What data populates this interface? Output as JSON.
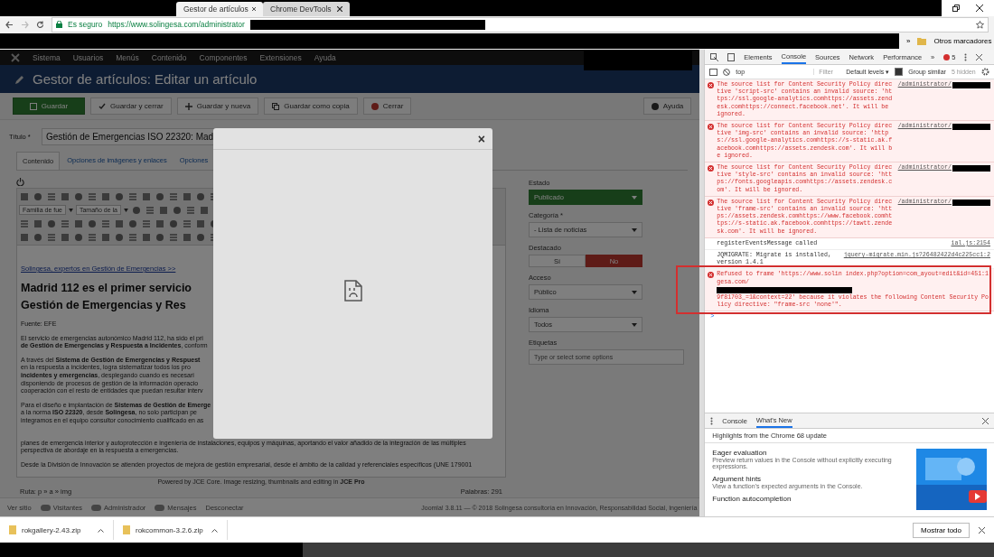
{
  "browser": {
    "tabs": [
      {
        "label": "Gestor de artículos",
        "selected": true
      },
      {
        "label": "Chrome DevTools",
        "selected": false
      }
    ],
    "secure_label": "Es seguro",
    "url": "https://www.solingesa.com/administrator",
    "bookmarks_overflow": "»",
    "other_bookmarks": "Otros marcadores"
  },
  "cms": {
    "menu": [
      "Sistema",
      "Usuarios",
      "Menús",
      "Contenido",
      "Componentes",
      "Extensiones",
      "Ayuda"
    ],
    "page_title": "Gestor de artículos: Editar un artículo",
    "toolbar": [
      {
        "label": "Guardar",
        "kind": "primary"
      },
      {
        "label": "Guardar y cerrar",
        "kind": "check"
      },
      {
        "label": "Guardar y nueva",
        "kind": "plus"
      },
      {
        "label": "Guardar como copia",
        "kind": "copy"
      },
      {
        "label": "Cerrar",
        "kind": "close"
      }
    ],
    "help": "Ayuda",
    "title_label": "Título *",
    "title_value": "Gestión de Emergencias ISO 22320: Mad",
    "tabs": [
      {
        "label": "Contenido",
        "selected": true
      },
      {
        "label": "Opciones de imágenes y enlaces",
        "selected": false
      },
      {
        "label": "Opciones",
        "selected": false
      }
    ],
    "editor": {
      "font_family": "Familia de fue",
      "font_size": "Tamaño de la",
      "intro_link": "Solingesa, expertos en Gestión de Emergencias >>",
      "heading": [
        "Madrid 112 es el primer servicio",
        "Gestión de Emergencias y Res"
      ],
      "source": "Fuente: EFE",
      "paragraphs": [
        [
          "El servicio de emergencias autonómico Madrid 112, ha sido el pri",
          "**de Gestión de Emergencias y Respuesta a Incidentes**, conform"
        ],
        [
          "A través del **Sistema de Gestión de Emergencias y Respuest**",
          "en la respuesta a incidentes, logra sistematizar todos los pro",
          "**incidentes y emergencias**, desplegando cuando es necesari",
          "disponiendo de procesos de gestión de la información operacio",
          "cooperación con el resto de entidades que puedan resultar interv"
        ],
        [
          "Para el diseño e implantación de **Sistemas de Gestión de Emerge**",
          "a la norma **ISO 22320**, desde **Solingesa**, no solo participan pe",
          "integramos en el equipo consultor conocimiento cualificado en as"
        ]
      ],
      "wide_lines": [
        [
          "planes de emergencia interior y autoprotección e ingeniería de instalaciones, equipos y máquinas, aportando el valor añadido de la integración de las múltiples",
          "perspectiva de abordaje en la respuesta a emergencias."
        ],
        [
          "Desde la División de Innovación se atienden proyectos de mejora de gestión empresarial, desde el ámbito de la calidad y referenciales específicos (UNE 179001"
        ]
      ],
      "powered": "Powered by JCE Core. Image resizing, thumbnails and editing in **JCE Pro**",
      "path": "Ruta: p » a » img",
      "words": "Palabras: 291"
    },
    "sidebar": [
      {
        "label": "Estado",
        "kind": "status",
        "value": "Publicado"
      },
      {
        "label": "Categoría *",
        "kind": "select",
        "value": "- Lista de noticias"
      },
      {
        "label": "Destacado",
        "kind": "toggle",
        "options": [
          {
            "label": "Sí",
            "selected": false
          },
          {
            "label": "No",
            "selected": true
          }
        ]
      },
      {
        "label": "Acceso",
        "kind": "select",
        "value": "Público"
      },
      {
        "label": "Idioma",
        "kind": "select",
        "value": "Todos"
      },
      {
        "label": "Etiquetas",
        "kind": "tags",
        "placeholder": "Type or select some options"
      }
    ],
    "status_bar": [
      {
        "label": "Ver sitio",
        "kind": "link"
      },
      {
        "label": "Visitantes",
        "kind": "badge"
      },
      {
        "label": "Administrador",
        "kind": "badge"
      },
      {
        "label": "Mensajes",
        "kind": "badge"
      },
      {
        "label": "Desconectar",
        "kind": "link"
      }
    ],
    "footer": "Joomla! 3.8.11 — © 2018 Solingesa consultoría en Innovación, Responsabilidad Social, Ingeniería",
    "modal": {
      "close": "×"
    }
  },
  "devtools": {
    "tabs": [
      {
        "label": "Elements",
        "selected": false
      },
      {
        "label": "Console",
        "selected": true
      },
      {
        "label": "Sources",
        "selected": false
      },
      {
        "label": "Network",
        "selected": false
      },
      {
        "label": "Performance",
        "selected": false
      }
    ],
    "more": "»",
    "error_count": "5",
    "context": "top",
    "filter_placeholder": "Filter",
    "levels": "Default levels ▾",
    "group_similar": {
      "label": "Group similar",
      "checked": true
    },
    "hidden": "5 hidden",
    "messages": [
      {
        "kind": "error",
        "text": "The source list for Content Security Policy directive 'script-src' contains an invalid source: 'https://ssl.google-analytics.comhttps://assets.zendesk.comhttps://connect.facebook.net'. It will be ignored.",
        "source": "/administrator/",
        "redacted": true
      },
      {
        "kind": "error",
        "text": "The source list for Content Security Policy directive 'img-src' contains an invalid source: 'https://ssl.google-analytics.comhttps://s-static.ak.facebook.comhttps://assets.zendesk.com'. It will be ignored.",
        "source": "/administrator/",
        "redacted": true
      },
      {
        "kind": "error",
        "text": "The source list for Content Security Policy directive 'style-src' contains an invalid source: 'https://fonts.googleapis.comhttps://assets.zendesk.com'. It will be ignored.",
        "source": "/administrator/",
        "redacted": true
      },
      {
        "kind": "error",
        "text": "The source list for Content Security Policy directive 'frame-src' contains an invalid source: 'https://assets.zendesk.comhttps://www.facebook.comhttps://s-static.ak.facebook.comhttps://tawtt.zendesk.com'. It will be ignored.",
        "source": "/administrator/",
        "redacted": true
      },
      {
        "kind": "info",
        "text": "registerEventsMessage called",
        "source": "ial.js:2154"
      },
      {
        "kind": "info",
        "text": "JQMIGRATE: Migrate is installed, version 1.4.1",
        "source": "jquery-migrate.min.js?26482422d4c225cc1:2"
      },
      {
        "kind": "error",
        "text": "Refused to frame 'https://www.solin index.php?option=com_ayout=edit&id=451:1gesa.com/",
        "text_after": "9f81703_=1&context=22' because it violates the following Content Security Policy directive: \"frame-src 'none'\".",
        "highlighted": true
      }
    ],
    "prompt": ">",
    "drawer": {
      "tabs": [
        {
          "label": "Console",
          "selected": false
        },
        {
          "label": "What's New",
          "selected": true
        }
      ],
      "heading": "Highlights from the Chrome 68 update",
      "items": [
        {
          "title": "Eager evaluation",
          "description": "Preview return values in the Console without explicitly executing expressions."
        },
        {
          "title": "Argument hints",
          "description": "View a function's expected arguments in the Console."
        },
        {
          "title": "Function autocompletion"
        }
      ]
    }
  },
  "downloads": {
    "files": [
      "rokgallery-2.43.zip",
      "rokcommon-3.2.6.zip"
    ],
    "show_all": "Mostrar todo"
  }
}
